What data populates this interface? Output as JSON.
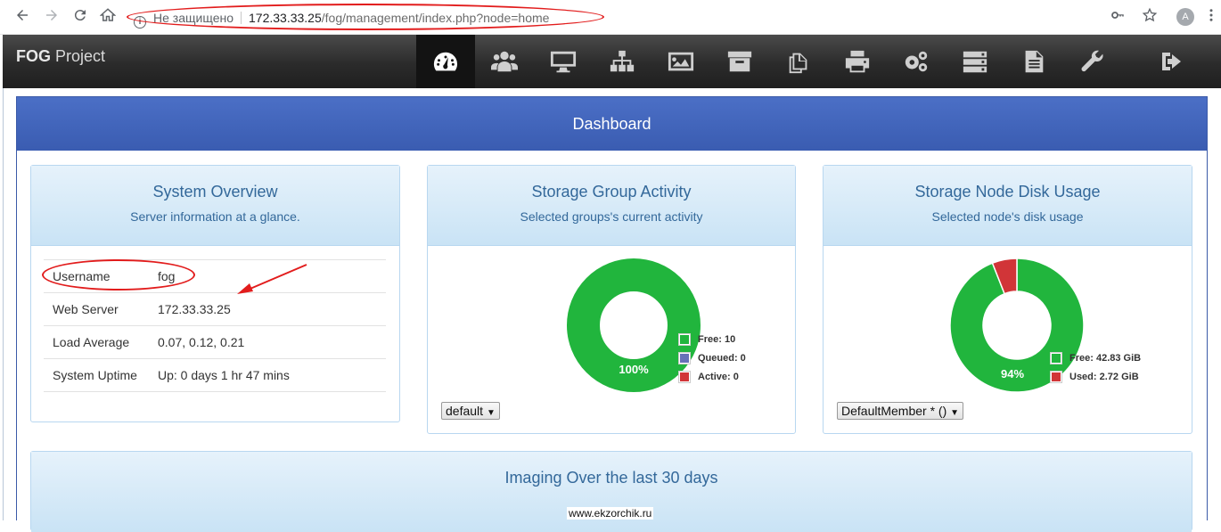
{
  "browser": {
    "insecure_label": "Не защищено",
    "url_host": "172.33.33.25",
    "url_path": "/fog/management/index.php?node=home",
    "profile_initial": "A"
  },
  "app": {
    "brand_bold": "FOG",
    "brand_rest": "Project",
    "menu": [
      {
        "icon": "dashboard-icon",
        "active": true
      },
      {
        "icon": "users-icon"
      },
      {
        "icon": "monitor-icon"
      },
      {
        "icon": "sitemap-icon"
      },
      {
        "icon": "image-icon"
      },
      {
        "icon": "archive-icon"
      },
      {
        "icon": "copy-icon"
      },
      {
        "icon": "printer-icon"
      },
      {
        "icon": "cogs-icon"
      },
      {
        "icon": "server-icon"
      },
      {
        "icon": "document-icon"
      },
      {
        "icon": "wrench-icon"
      }
    ],
    "logout_icon": "sign-out-icon"
  },
  "dashboard": {
    "title": "Dashboard",
    "system_overview": {
      "title": "System Overview",
      "subtitle": "Server information at a glance.",
      "rows": [
        {
          "label": "Username",
          "value": "fog"
        },
        {
          "label": "Web Server",
          "value": "172.33.33.25"
        },
        {
          "label": "Load Average",
          "value": "0.07, 0.12, 0.21"
        },
        {
          "label": "System Uptime",
          "value": "Up: 0 days 1 hr 47 mins"
        }
      ]
    },
    "storage_group": {
      "title": "Storage Group Activity",
      "subtitle": "Selected groups's current activity",
      "select_value": "default",
      "center_label": "100%",
      "legend": [
        {
          "label": "Free: 10",
          "color": "#21b53d"
        },
        {
          "label": "Queued: 0",
          "color": "#6771b8"
        },
        {
          "label": "Active: 0",
          "color": "#d13538"
        }
      ]
    },
    "storage_node": {
      "title": "Storage Node Disk Usage",
      "subtitle": "Selected node's disk usage",
      "select_value": "DefaultMember * ()",
      "center_label": "94%",
      "legend": [
        {
          "label": "Free: 42.83 GiB",
          "color": "#21b53d"
        },
        {
          "label": "Used: 2.72 GiB",
          "color": "#d13538"
        }
      ]
    },
    "imaging": {
      "title": "Imaging Over the last 30 days"
    }
  },
  "chart_data": [
    {
      "type": "pie",
      "categories": [
        "Free",
        "Queued",
        "Active"
      ],
      "values": [
        10,
        0,
        0
      ],
      "title": "Storage Group Activity"
    },
    {
      "type": "pie",
      "categories": [
        "Free",
        "Used"
      ],
      "values": [
        42.83,
        2.72
      ],
      "title": "Storage Node Disk Usage"
    }
  ],
  "watermark": "www.ekzorchik.ru"
}
